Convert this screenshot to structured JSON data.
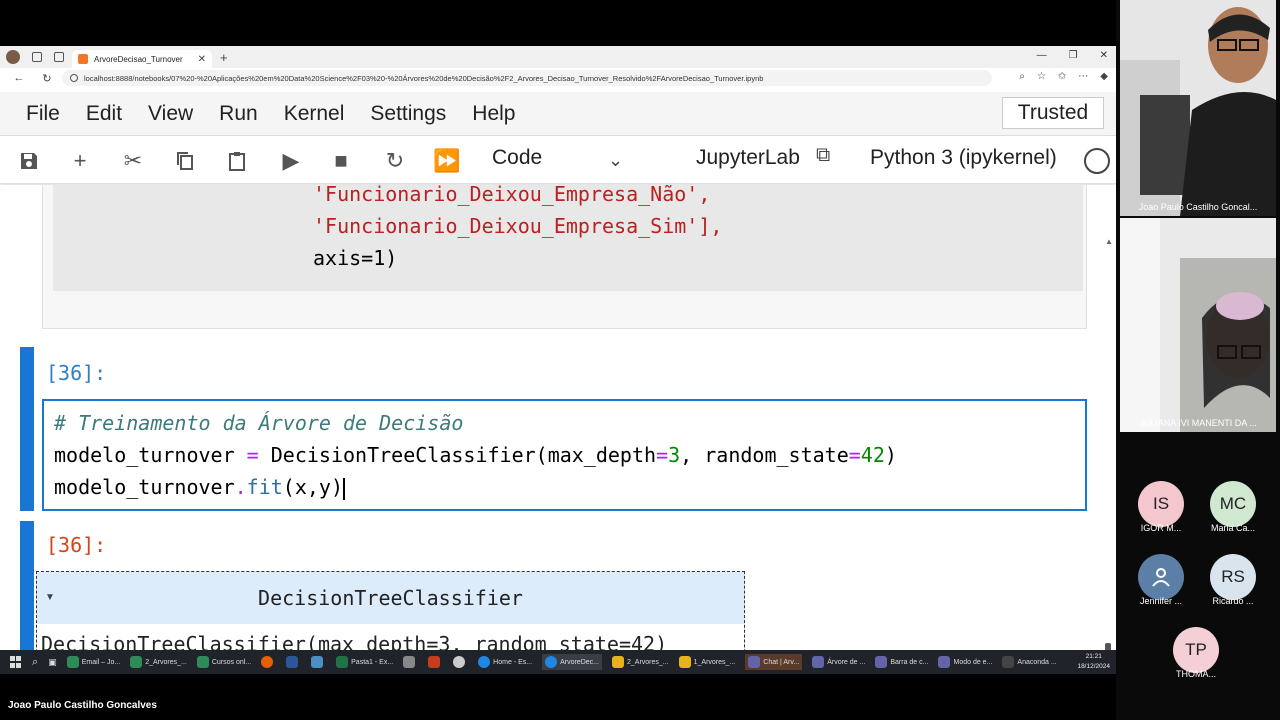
{
  "browser": {
    "tab_title": "ArvoreDecisao_Turnover",
    "url": "localhost:8888/notebooks/07%20-%20Aplicações%20em%20Data%20Science%2F03%20-%20Árvores%20de%20Decisão%2F2_Arvores_Decisao_Turnover_Resolvido%2FArvoreDecisao_Turnover.ipynb"
  },
  "menu": {
    "items": [
      "File",
      "Edit",
      "View",
      "Run",
      "Kernel",
      "Settings",
      "Help"
    ],
    "trusted": "Trusted"
  },
  "toolbar": {
    "cell_type": "Code",
    "jupyterlab_label": "JupyterLab",
    "kernel_name": "Python 3 (ipykernel)"
  },
  "cells": {
    "prev_lines": [
      "'Funcionario_Deixou_Empresa_Não',",
      "'Funcionario_Deixou_Empresa_Sim'],",
      "axis=1)"
    ],
    "in_prompt": "[36]:",
    "in_comment": "# Treinamento da Árvore de Decisão",
    "out_prompt": "[36]:",
    "out_header": "DecisionTreeClassifier",
    "out_body": "DecisionTreeClassifier(max_depth=3, random_state=42)"
  },
  "taskbar": {
    "items": [
      "Email – Jo...",
      "2_Arvores_...",
      "Cursos onl...",
      "Pasta1 - Ex...",
      "Home - Es...",
      "ArvoreDec...",
      "2_Arvores_...",
      "1_Arvores_...",
      "Chat | Arv...",
      "Árvore de ...",
      "Barra de c...",
      "Modo de e...",
      "Anaconda ..."
    ],
    "time": "21:21",
    "date": "18/12/2024"
  },
  "participants": {
    "presenter": "Joao Paulo Castilho Goncal...",
    "second": "JULIANA IVI MANENTI DA ...",
    "avatars": [
      {
        "initials": "IS",
        "name": "IGOR M...",
        "color": "#f4c7cf"
      },
      {
        "initials": "MC",
        "name": "Maria Ca...",
        "color": "#cfe8cf"
      },
      {
        "initials": "",
        "name": "Jennifer ...",
        "color": "#5b7fa6"
      },
      {
        "initials": "RS",
        "name": "Ricardo ...",
        "color": "#d8e4ee"
      },
      {
        "initials": "TP",
        "name": "THOMA...",
        "color": "#f4cfd6"
      }
    ]
  },
  "caption": "Joao Paulo Castilho Goncalves"
}
